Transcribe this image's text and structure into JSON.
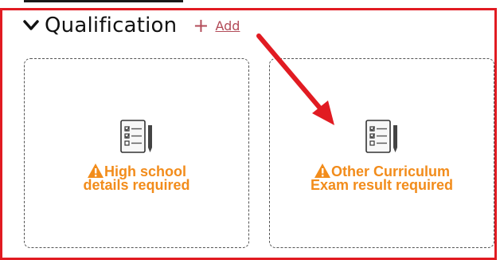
{
  "section": {
    "title": "Qualification",
    "add_label": "Add"
  },
  "cards": [
    {
      "line1": "High school",
      "line2": "details required"
    },
    {
      "line1": "Other Curriculum",
      "line2": "Exam result required"
    }
  ],
  "colors": {
    "outline": "#e11b22",
    "warning_text": "#f28c1b",
    "add_link": "#b24b58",
    "arrow": "#e11b22"
  },
  "icons": [
    "chevron-down-icon",
    "plus-icon",
    "document-checklist-icon",
    "warning-icon",
    "annotation-arrow"
  ]
}
